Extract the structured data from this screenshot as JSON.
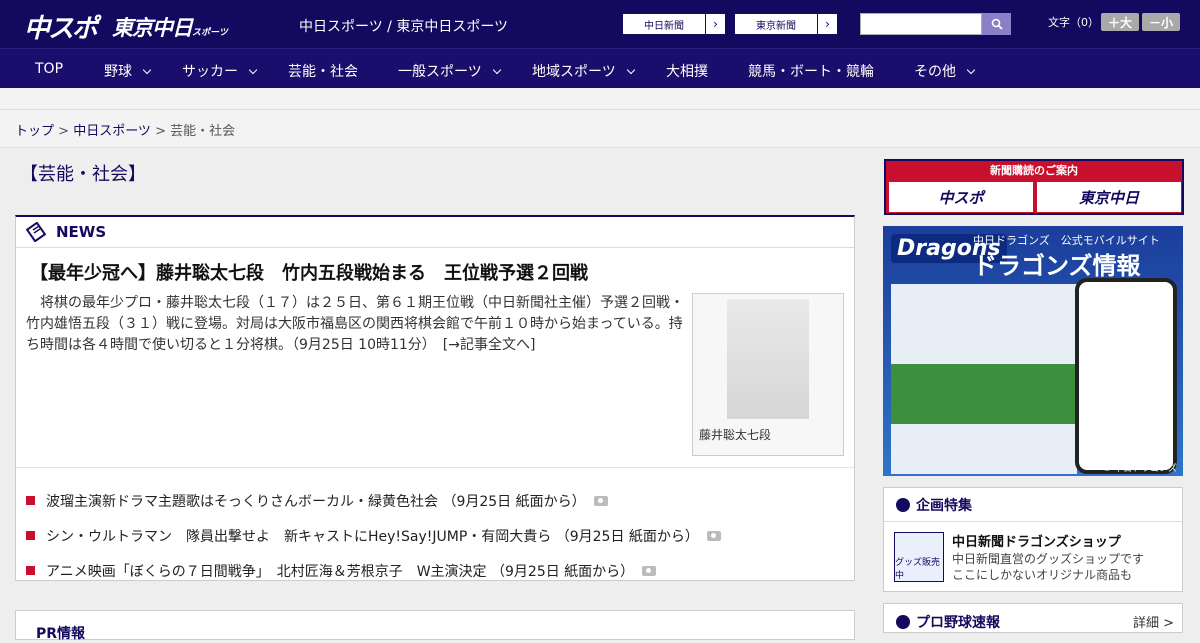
{
  "header": {
    "logo_chuspo": "中スポ",
    "logo_tokyo": "東京中日",
    "logo_tokyo_small": "スポーツ",
    "site_name": "中日スポーツ / 東京中日スポーツ",
    "btn_chunichi": "中日新聞",
    "btn_tokyo": "東京新聞",
    "search_placeholder": "",
    "font_label": "文字（0）",
    "font_big": "＋大",
    "font_small": "－小"
  },
  "nav": [
    "TOP",
    "野球",
    "サッカー",
    "芸能・社会",
    "一般スポーツ",
    "地域スポーツ",
    "大相撲",
    "競馬・ボート・競輪",
    "その他"
  ],
  "breadcrumb": {
    "top": "トップ",
    "chuspo": "中日スポーツ",
    "current": "芸能・社会"
  },
  "page_title": "【芸能・社会】",
  "news": {
    "label": "NEWS",
    "headline": "【最年少冠へ】藤井聡太七段　竹内五段戦始まる　王位戦予選２回戦",
    "body": "　将棋の最年少プロ・藤井聡太七段（１７）は２５日、第６１期王位戦（中日新聞社主催）予選２回戦・竹内雄悟五段（３１）戦に登場。対局は大阪市福島区の関西将棋会館で午前１０時から始まっている。持ち時間は各４時間で使い切ると１分将棋。（9月25日 10時11分）　[→記事全文へ]",
    "photo_caption": "藤井聡太七段",
    "items": [
      "波瑠主演新ドラマ主題歌はそっくりさんボーカル・緑黄色社会 （9月25日 紙面から）",
      "シン・ウルトラマン　隊員出撃せよ　新キャストにHey!Say!JUMP・有岡大貴ら （9月25日 紙面から）",
      "アニメ映画「ぼくらの７日間戦争」　北村匠海＆芳根京子　W主演決定 （9月25日 紙面から）"
    ]
  },
  "pr": {
    "label": "PR情報"
  },
  "sidebar": {
    "subscribe_title": "新聞購読のご案内",
    "subscribe_chuspo": "中スポ",
    "subscribe_tokyo": "東京中日",
    "dragons_logo": "Dragons",
    "dragons_sub": "中日ドラゴンズ　公式モバイルサイト",
    "dragons_main": "ドラゴンズ情報",
    "dragons_copy": "© 中日ドラゴンズ",
    "kikaku_title": "企画特集",
    "shop_title": "中日新聞ドラゴンズショップ",
    "shop_desc1": "中日新聞直営のグッズショップです",
    "shop_desc2": "ここにしかないオリジナル商品も",
    "shop_badge": "グッズ販売中",
    "baseball_title": "プロ野球速報",
    "baseball_more": "詳細 >"
  }
}
